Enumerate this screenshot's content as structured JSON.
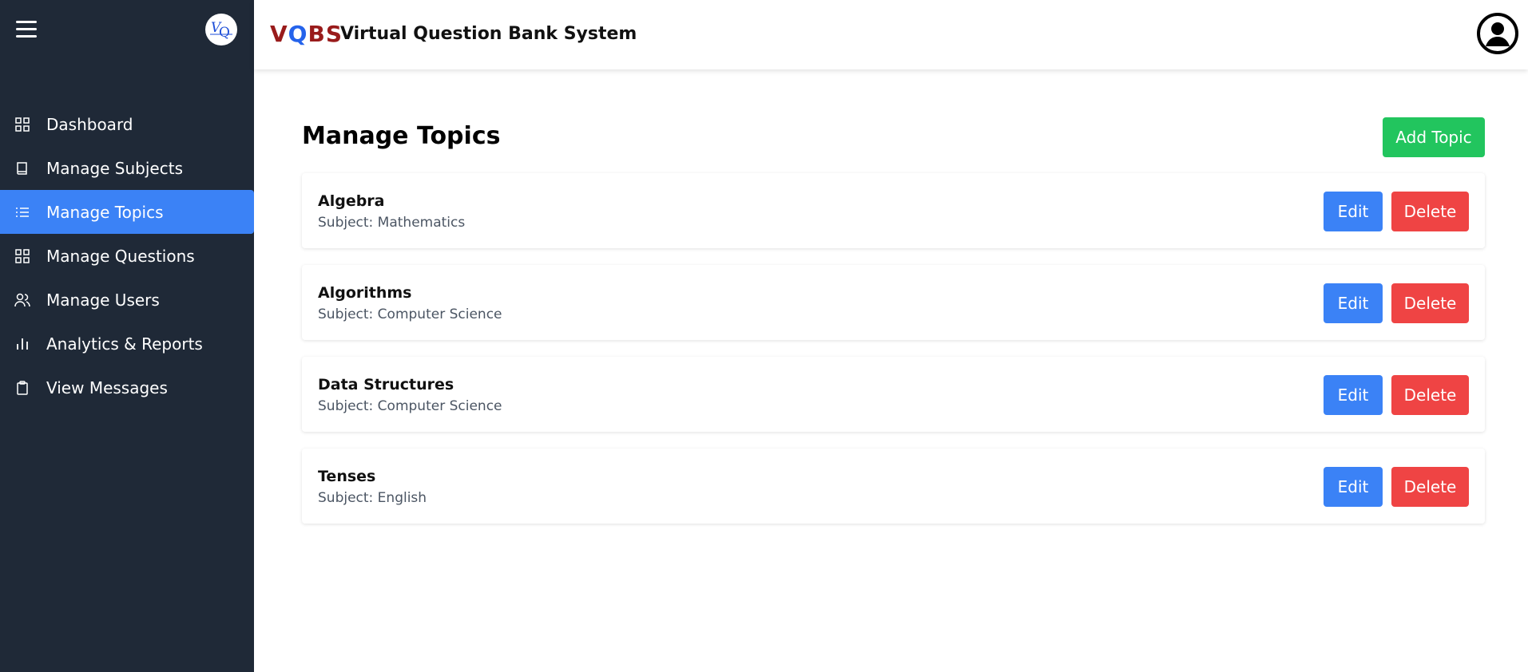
{
  "sidebar": {
    "menu_icon": "hamburger-icon",
    "logo_text": "VQ",
    "items": [
      {
        "label": "Dashboard",
        "icon": "grid-icon"
      },
      {
        "label": "Manage Subjects",
        "icon": "book-icon"
      },
      {
        "label": "Manage Topics",
        "icon": "list-icon",
        "active": true
      },
      {
        "label": "Manage Questions",
        "icon": "grid-icon"
      },
      {
        "label": "Manage Users",
        "icon": "users-icon"
      },
      {
        "label": "Analytics & Reports",
        "icon": "bar-chart-icon"
      },
      {
        "label": "View Messages",
        "icon": "clipboard-icon"
      }
    ]
  },
  "header": {
    "brand_v": "V",
    "brand_q": "Q",
    "brand_bs": "BS",
    "title": "Virtual Question Bank System",
    "profile_icon": "user-circle-icon"
  },
  "main": {
    "page_title": "Manage Topics",
    "add_button": "Add Topic",
    "edit_label": "Edit",
    "delete_label": "Delete",
    "topics": [
      {
        "name": "Algebra",
        "subject": "Subject: Mathematics"
      },
      {
        "name": "Algorithms",
        "subject": "Subject: Computer Science"
      },
      {
        "name": "Data Structures",
        "subject": "Subject: Computer Science"
      },
      {
        "name": "Tenses",
        "subject": "Subject: English"
      }
    ]
  },
  "colors": {
    "sidebar_bg": "#1f2937",
    "active": "#3b82f6",
    "add": "#22c55e",
    "edit": "#3b82f6",
    "delete": "#ef4444"
  }
}
